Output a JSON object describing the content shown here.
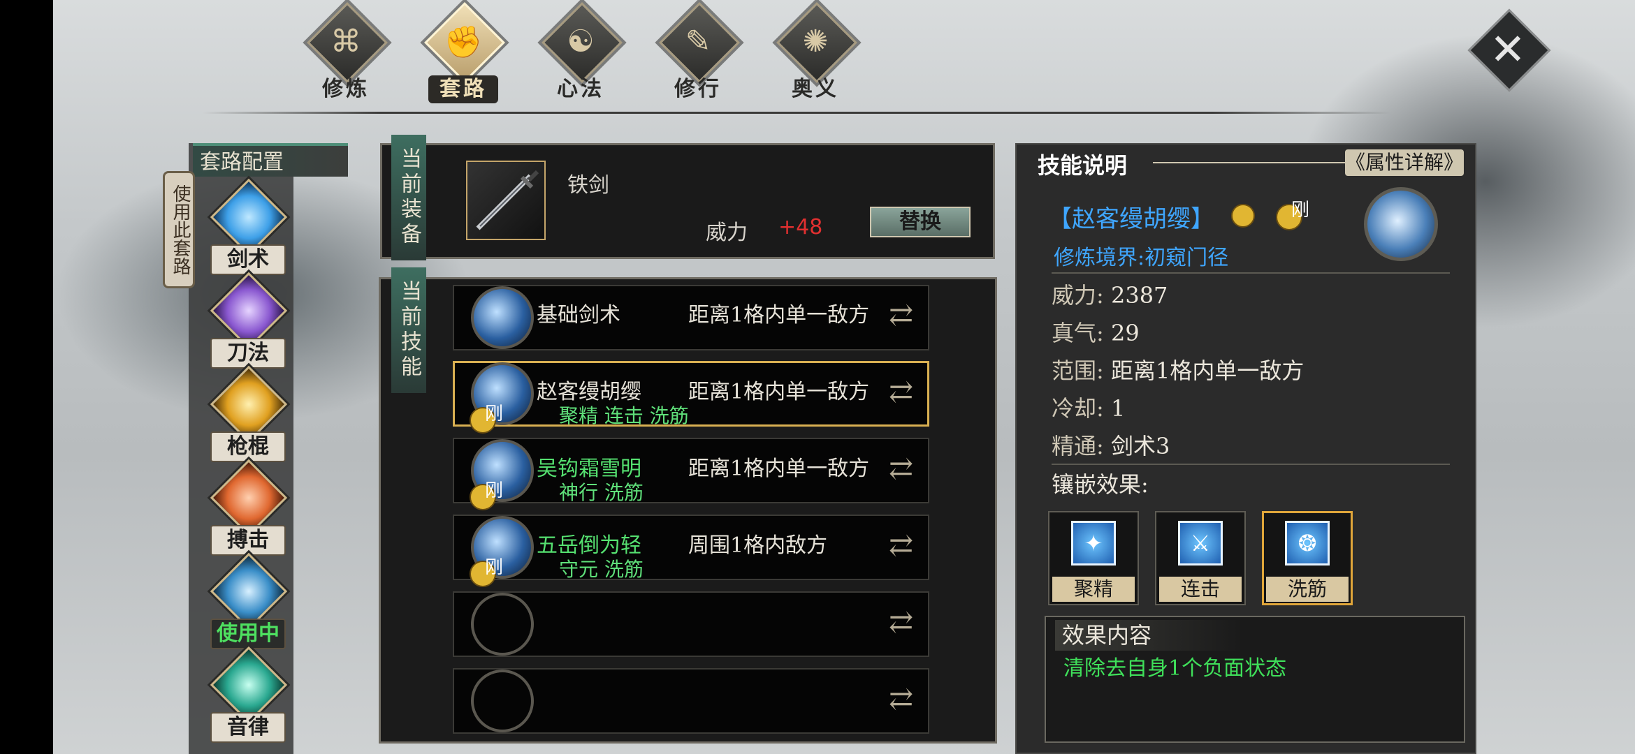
{
  "top_nav": {
    "tabs": [
      {
        "label": "修炼",
        "glyph": "⌘",
        "active": false
      },
      {
        "label": "套路",
        "glyph": "✊",
        "active": true
      },
      {
        "label": "心法",
        "glyph": "☯",
        "active": false
      },
      {
        "label": "修行",
        "glyph": "✎",
        "active": false
      },
      {
        "label": "奥义",
        "glyph": "✺",
        "active": false
      }
    ],
    "close_glyph": "✕"
  },
  "sidebar": {
    "title": "套路配置",
    "use_label": "使用此套路",
    "weapons": [
      {
        "label": "剑术",
        "color": "#3ea0e8"
      },
      {
        "label": "刀法",
        "color": "#8a58d0"
      },
      {
        "label": "枪棍",
        "color": "#e0a020"
      },
      {
        "label": "搏击",
        "color": "#e06830"
      },
      {
        "label": "使用中",
        "color": "#3a8ec8"
      },
      {
        "label": "音律",
        "color": "#2aa890"
      }
    ]
  },
  "equipment": {
    "tab_label": "当前装备",
    "item_name": "铁剑",
    "power_label": "威力",
    "power_value": "+48",
    "replace_label": "替换"
  },
  "skills": {
    "tab_label": "当前技能",
    "badge": "刚",
    "swap_glyph": "⇄",
    "rows": [
      {
        "name": "基础剑术",
        "range": "距离1格内单一敌方",
        "tags": "",
        "name_green": false,
        "badge": false,
        "empty": false,
        "selected": false
      },
      {
        "name": "赵客缦胡缨",
        "range": "距离1格内单一敌方",
        "tags": "聚精 连击 洗筋",
        "name_green": false,
        "badge": true,
        "empty": false,
        "selected": true
      },
      {
        "name": "吴钩霜雪明",
        "range": "距离1格内单一敌方",
        "tags": "神行 洗筋",
        "name_green": true,
        "badge": true,
        "empty": false,
        "selected": false
      },
      {
        "name": "五岳倒为轻",
        "range": "周围1格内敌方",
        "tags": "守元 洗筋",
        "name_green": true,
        "badge": true,
        "empty": false,
        "selected": false
      },
      {
        "name": "",
        "range": "",
        "tags": "",
        "name_green": false,
        "badge": false,
        "empty": true,
        "selected": false
      },
      {
        "name": "",
        "range": "",
        "tags": "",
        "name_green": false,
        "badge": false,
        "empty": true,
        "selected": false
      }
    ]
  },
  "detail": {
    "title": "技能说明",
    "attr_button": "《属性详解》",
    "skill_title": "【赵客缦胡缨】",
    "badge": "刚",
    "realm": "修炼境界:初窥门径",
    "stats": [
      {
        "key": "威力:",
        "value": "2387"
      },
      {
        "key": "真气:",
        "value": "29"
      },
      {
        "key": "范围:",
        "value": "距离1格内单一敌方"
      },
      {
        "key": "冷却:",
        "value": "1"
      },
      {
        "key": "精通:",
        "value": "剑术3"
      }
    ],
    "inlay_label": "镶嵌效果:",
    "inlays": [
      {
        "name": "聚精",
        "glyph": "✦",
        "selected": false
      },
      {
        "name": "连击",
        "glyph": "⚔",
        "selected": false
      },
      {
        "name": "洗筋",
        "glyph": "❂",
        "selected": true
      }
    ],
    "effect_head": "效果内容",
    "effect_text": "清除去自身1个负面状态"
  }
}
